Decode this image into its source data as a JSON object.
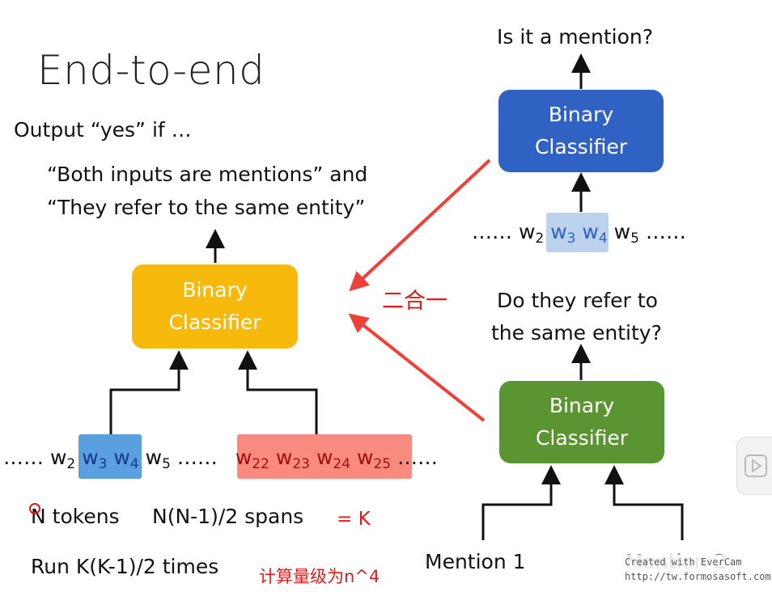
{
  "title": "End-to-end",
  "output_line": "Output “yes” if …",
  "condition_1": "“Both inputs are mentions” and",
  "condition_2": "“They refer to the same entity”",
  "left_classifier": {
    "line1": "Binary",
    "line2": "Classifier"
  },
  "sequence": {
    "prefix": "…… w",
    "parts": [
      "2",
      "w",
      "3",
      "w",
      "4",
      "w",
      "5"
    ],
    "mid": "……",
    "span2": [
      "w",
      "22",
      "w",
      "23",
      "w",
      "24",
      "w",
      "25"
    ],
    "suffix": "……"
  },
  "tokens_line": "N tokens",
  "spans_line": "N(N-1)/2 spans",
  "equals_k": "= K",
  "run_line": "Run K(K-1)/2 times",
  "complexity_note": "计算量级为n^4",
  "top_question": "Is it a mention?",
  "top_classifier": {
    "line1": "Binary",
    "line2": "Classifier"
  },
  "top_sequence": "…… w2 w3 w4 w5 ……",
  "merge_label": "二合一",
  "refer_question_1": "Do they refer to",
  "refer_question_2": "the same entity?",
  "bottom_classifier": {
    "line1": "Binary",
    "line2": "Classifier"
  },
  "mention_1": "Mention 1",
  "mention_2": "Mention 2",
  "watermark_1": "Created with EverCam",
  "watermark_2": "http://tw.formosasoft.com",
  "colors": {
    "yellow": "#f7b90b",
    "blue": "#2f62c3",
    "green": "#5a9532",
    "red_arrow": "#f0403a",
    "highlight_blue": "#5aa0e0",
    "highlight_red": "#f98a80"
  }
}
